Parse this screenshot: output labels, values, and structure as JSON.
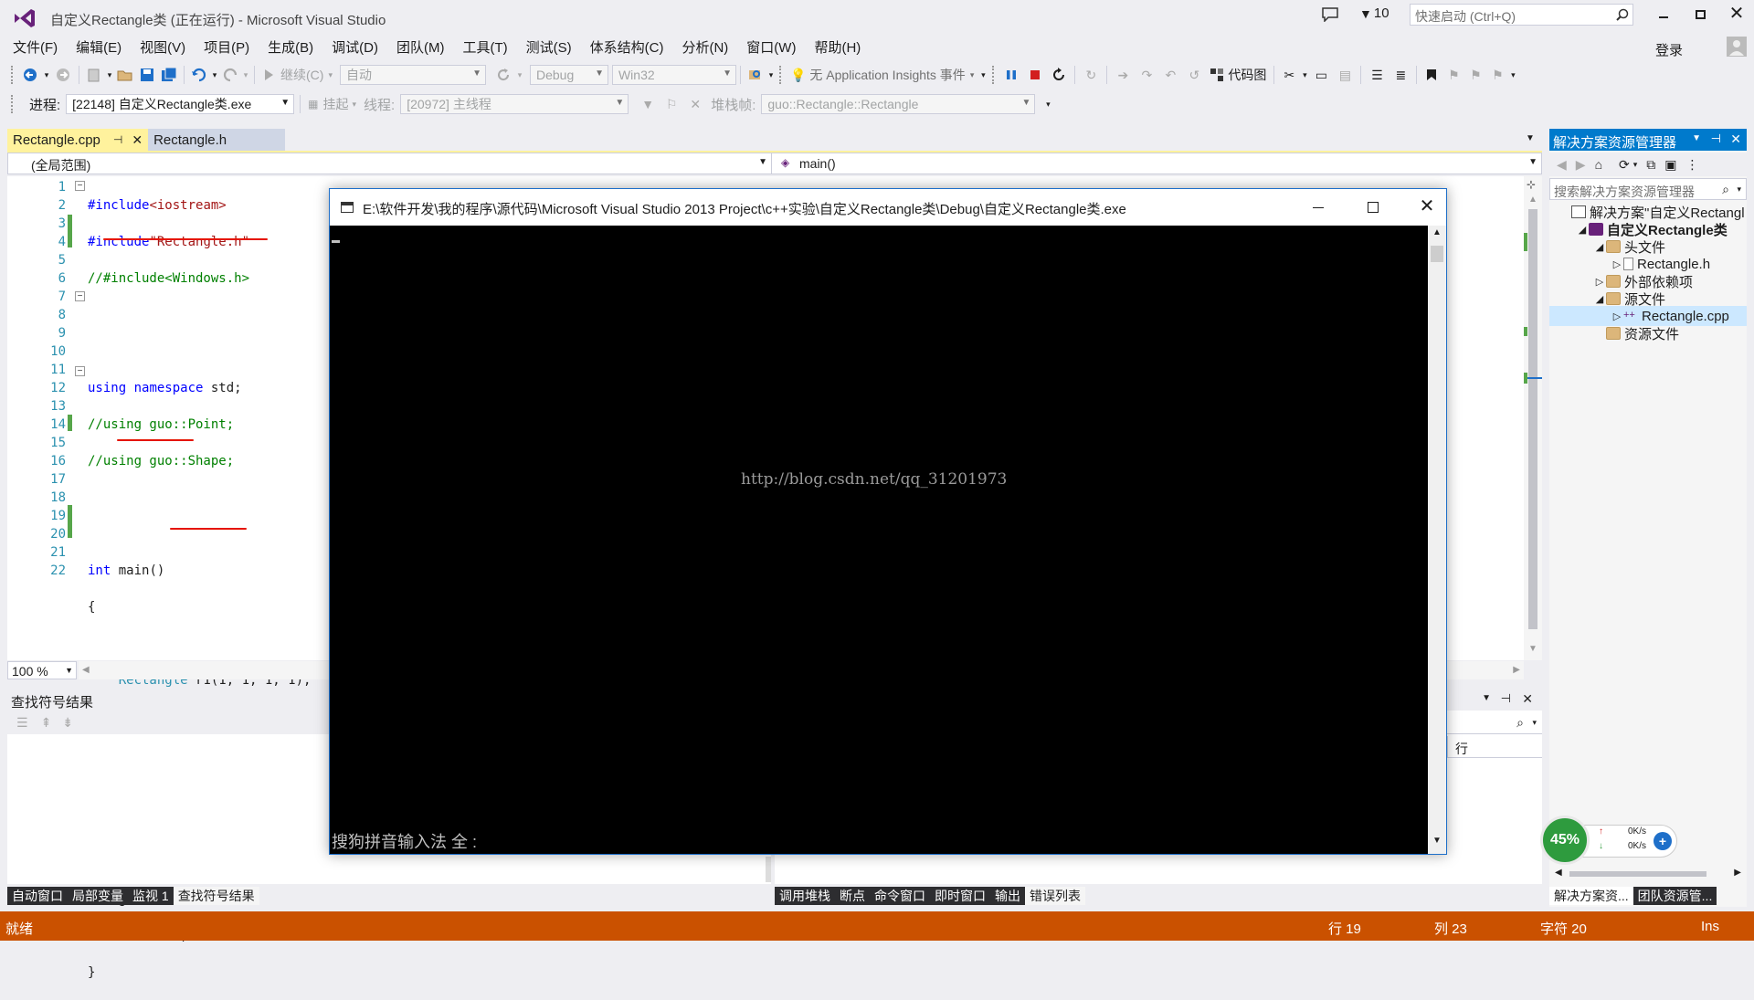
{
  "window": {
    "title": "自定义Rectangle类 (正在运行) - Microsoft Visual Studio",
    "notification_count": "10",
    "quick_launch_placeholder": "快速启动 (Ctrl+Q)",
    "login": "登录"
  },
  "menu": [
    "文件(F)",
    "编辑(E)",
    "视图(V)",
    "项目(P)",
    "生成(B)",
    "调试(D)",
    "团队(M)",
    "工具(T)",
    "测试(S)",
    "体系结构(C)",
    "分析(N)",
    "窗口(W)",
    "帮助(H)"
  ],
  "toolbar": {
    "continue": "继续(C)",
    "auto": "自动",
    "config": "Debug",
    "platform": "Win32",
    "insights": "无 Application Insights 事件",
    "codemap": "代码图"
  },
  "debugbar": {
    "process_label": "进程:",
    "process_value": "[22148] 自定义Rectangle类.exe",
    "suspend": "挂起",
    "thread_label": "线程:",
    "thread_value": "[20972] 主线程",
    "stackframe_label": "堆栈帧:",
    "stackframe_value": "guo::Rectangle::Rectangle"
  },
  "editor": {
    "tabs": [
      {
        "label": "Rectangle.cpp",
        "active": true
      },
      {
        "label": "Rectangle.h",
        "active": false
      }
    ],
    "scope": "(全局范围)",
    "member": "main()",
    "zoom": "100 %",
    "line_numbers": [
      "1",
      "2",
      "3",
      "4",
      "5",
      "6",
      "7",
      "8",
      "9",
      "10",
      "11",
      "12",
      "13",
      "14",
      "15",
      "16",
      "17",
      "18",
      "19",
      "20",
      "21",
      "22"
    ]
  },
  "console": {
    "title": "E:\\软件开发\\我的程序\\源代码\\Microsoft Visual Studio 2013 Project\\c++实验\\自定义Rectangle类\\Debug\\自定义Rectangle类.exe",
    "watermark": "http://blog.csdn.net/qq_31201973",
    "ime": "搜狗拼音输入法 全 :"
  },
  "solution": {
    "title": "解决方案资源管理器",
    "search_placeholder": "搜索解决方案资源管理器",
    "items": [
      {
        "label": "解决方案\"自定义Rectangl",
        "level": 0,
        "icon": "solution-icon"
      },
      {
        "label": "自定义Rectangle类",
        "level": 1,
        "icon": "project-icon",
        "bold": true
      },
      {
        "label": "头文件",
        "level": 2,
        "icon": "folder-icon"
      },
      {
        "label": "Rectangle.h",
        "level": 3,
        "icon": "header-file-icon"
      },
      {
        "label": "外部依赖项",
        "level": 2,
        "icon": "folder-icon"
      },
      {
        "label": "源文件",
        "level": 2,
        "icon": "folder-icon"
      },
      {
        "label": "Rectangle.cpp",
        "level": 3,
        "icon": "cpp-file-icon",
        "selected": true
      },
      {
        "label": "资源文件",
        "level": 2,
        "icon": "folder-icon"
      }
    ],
    "bottom_tabs": [
      "解决方案资...",
      "团队资源管..."
    ]
  },
  "find_results": {
    "title": "查找符号结果"
  },
  "errorlist": {
    "col_line": "行"
  },
  "left_bottom_tabs": [
    "自动窗口",
    "局部变量",
    "监视 1",
    "查找符号结果"
  ],
  "right_bottom_tabs": [
    "调用堆栈",
    "断点",
    "命令窗口",
    "即时窗口",
    "输出",
    "错误列表"
  ],
  "widget": {
    "percent": "45%",
    "up": "0K/s",
    "down": "0K/s"
  },
  "status": {
    "ready": "就绪",
    "line": "行 19",
    "col": "列 23",
    "char": "字符 20",
    "ins": "Ins"
  },
  "colors": {
    "accent": "#007acc",
    "statusbar": "#ca5100",
    "tab_active": "#fff29d"
  }
}
